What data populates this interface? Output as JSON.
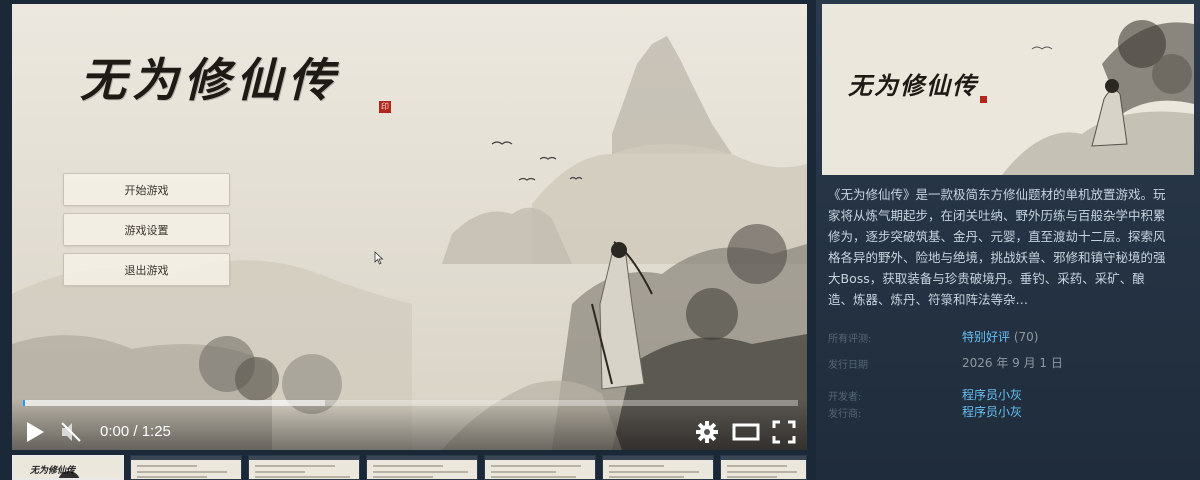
{
  "video": {
    "game_title": "无为修仙传",
    "seal_char": "印",
    "menu": {
      "start": "开始游戏",
      "settings": "游戏设置",
      "quit": "退出游戏"
    },
    "player": {
      "time_display": "0:00 / 1:25",
      "progress_fraction": 0.0,
      "buffered_fraction": 0.39,
      "icons": [
        "play-icon",
        "mute-icon",
        "gear-icon",
        "theater-icon",
        "fullscreen-icon"
      ]
    }
  },
  "thumbnails": {
    "count": 7,
    "active_index": 0,
    "first_title": "无为修仙传"
  },
  "panel": {
    "capsule_title": "无为修仙传",
    "description": "《无为修仙传》是一款极简东方修仙题材的单机放置游戏。玩家将从炼气期起步，在闭关吐纳、野外历练与百般杂学中积累修为，逐步突破筑基、金丹、元婴，直至渡劫十二层。探索风格各异的野外、险地与绝境，挑战妖兽、邪修和镇守秘境的强大Boss，获取装备与珍贵破境丹。垂钓、采药、采矿、酿造、炼器、炼丹、符箓和阵法等杂…",
    "reviews_label": "所有评测:",
    "reviews_value": "特别好评",
    "reviews_count": "(70)",
    "release_label": "发行日期",
    "release_value": "2026 年 9 月 1 日",
    "developer_label": "开发者:",
    "developer_value": "程序员小灰",
    "publisher_label": "发行商:",
    "publisher_value": "程序员小灰"
  },
  "colors": {
    "page_bg": "#1b2838",
    "link": "#66c0f4",
    "text": "#c6d4df",
    "label": "#556772",
    "progress": "#1a9fff",
    "seal": "#b3261e"
  }
}
